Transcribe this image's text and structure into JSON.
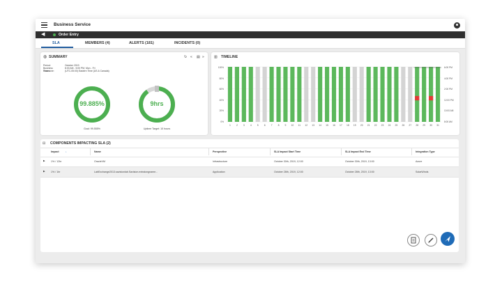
{
  "header": {
    "title": "Business Service"
  },
  "subheader": {
    "entry_label": "Order Entry"
  },
  "tabs": [
    {
      "label": "SLA"
    },
    {
      "label": "MEMBERS (4)"
    },
    {
      "label": "ALERTS (181)"
    },
    {
      "label": "INCIDENTS (0)"
    }
  ],
  "summary": {
    "title": "SUMMARY",
    "rows": [
      {
        "key": "Period:",
        "value": "October 2019"
      },
      {
        "key": "Business Hours:",
        "value": "8:00 AM - 5:00 PM, Mon - Fri"
      },
      {
        "key": "Timezone:",
        "value": "(UTC-05:00) Eastern Time (US & Canada)"
      }
    ],
    "sla": {
      "value": "99.885%",
      "caption": "Goal: 99.555%",
      "fraction": 0.99885,
      "goal_fraction": 0.99555
    },
    "uptime": {
      "value": "9hrs",
      "caption": "Uptime Target: 10 hours",
      "fraction": 0.9
    }
  },
  "timeline": {
    "title": "TIMELINE",
    "y_labels": [
      "100%",
      "80%",
      "60%",
      "40%",
      "20%",
      "0%"
    ],
    "right_labels": [
      "6:00 PM",
      "4:00 PM",
      "2:00 PM",
      "12:00 PM",
      "10:00 AM",
      "8:00 AM"
    ],
    "days": [
      "1",
      "2",
      "3",
      "4",
      "5",
      "6",
      "7",
      "8",
      "9",
      "10",
      "11",
      "12",
      "13",
      "14",
      "15",
      "16",
      "17",
      "18",
      "19",
      "20",
      "21",
      "22",
      "23",
      "24",
      "25",
      "26",
      "27",
      "28",
      "29",
      "30",
      "31"
    ],
    "bar_status": [
      "g",
      "g",
      "g",
      "g",
      "x",
      "x",
      "g",
      "g",
      "g",
      "g",
      "g",
      "x",
      "x",
      "g",
      "g",
      "g",
      "g",
      "g",
      "x",
      "x",
      "g",
      "g",
      "g",
      "g",
      "g",
      "x",
      "x",
      "gr",
      "g",
      "gr",
      "g"
    ],
    "colors": {
      "green": "#5cb85c",
      "gray": "#d4d4d4",
      "red": "#e53935"
    }
  },
  "components": {
    "title": "COMPONENTS IMPACTING SLA (2)",
    "columns": [
      "Impact",
      "Name",
      "Perspective",
      "SLA Impact Start Time",
      "SLA Impact End Time",
      "Integration Type"
    ],
    "sort_indicator": "↓",
    "rows": [
      {
        "impact": "1% / 12hr",
        "name": "OracleVM",
        "perspective": "Infrastructure",
        "start": "October 30th, 2019, 12:00",
        "end": "October 30th, 2019, 13:00",
        "integration": "Azure"
      },
      {
        "impact": "1% / 1hr",
        "name": "LabExchange2013.savisionlab.Savision.extralongname...",
        "perspective": "Application",
        "start": "October 28th, 2019, 12:00",
        "end": "October 28th, 2019, 13:00",
        "integration": "SolarWinds"
      }
    ]
  },
  "colors": {
    "accent": "#1f5b9e",
    "primary_fab": "#1f6bb7",
    "green": "#4caf50",
    "dark_bar": "#2f2f2f"
  }
}
